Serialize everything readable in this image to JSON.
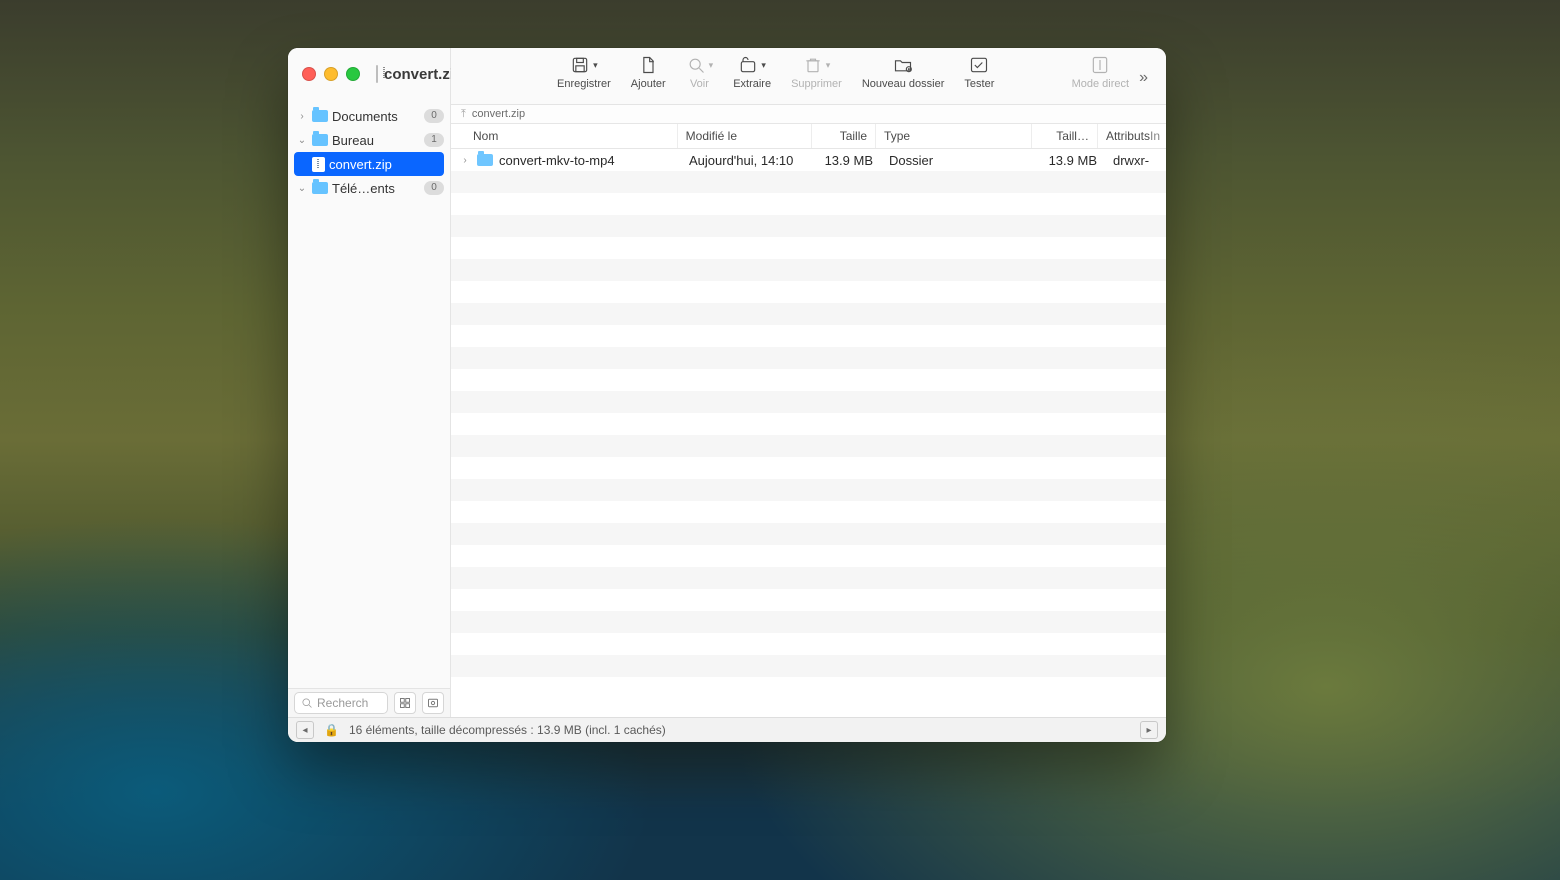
{
  "window": {
    "title": "convert.zip"
  },
  "toolbar": {
    "save": {
      "label": "Enregistrer"
    },
    "add": {
      "label": "Ajouter"
    },
    "view": {
      "label": "Voir"
    },
    "extract": {
      "label": "Extraire"
    },
    "delete": {
      "label": "Supprimer"
    },
    "newfolder": {
      "label": "Nouveau dossier"
    },
    "test": {
      "label": "Tester"
    },
    "direct": {
      "label": "Mode direct"
    }
  },
  "sidebar": {
    "items": [
      {
        "label": "Documents",
        "badge": "0",
        "kind": "folder",
        "expand": "closed"
      },
      {
        "label": "Bureau",
        "badge": "1",
        "kind": "folder",
        "expand": "open",
        "children": [
          {
            "label": "convert.zip",
            "kind": "zip",
            "selected": true
          }
        ]
      },
      {
        "label": "Télé…ents",
        "badge": "0",
        "kind": "folder",
        "expand": "open"
      }
    ],
    "search_placeholder": "Recherch"
  },
  "breadcrumb": {
    "root": "convert.zip"
  },
  "columns": {
    "name": "Nom",
    "modified": "Modifié le",
    "size": "Taille",
    "type": "Type",
    "csize": "Taill…",
    "attrs": "Attributs",
    "extra": "In"
  },
  "rows": [
    {
      "name": "convert-mkv-to-mp4",
      "modified": "Aujourd'hui, 14:10",
      "size": "13.9 MB",
      "type": "Dossier",
      "csize": "13.9 MB",
      "attrs": "drwxr-"
    }
  ],
  "status": {
    "text": "16 éléments, taille décompressés : 13.9 MB (incl. 1 cachés)"
  }
}
